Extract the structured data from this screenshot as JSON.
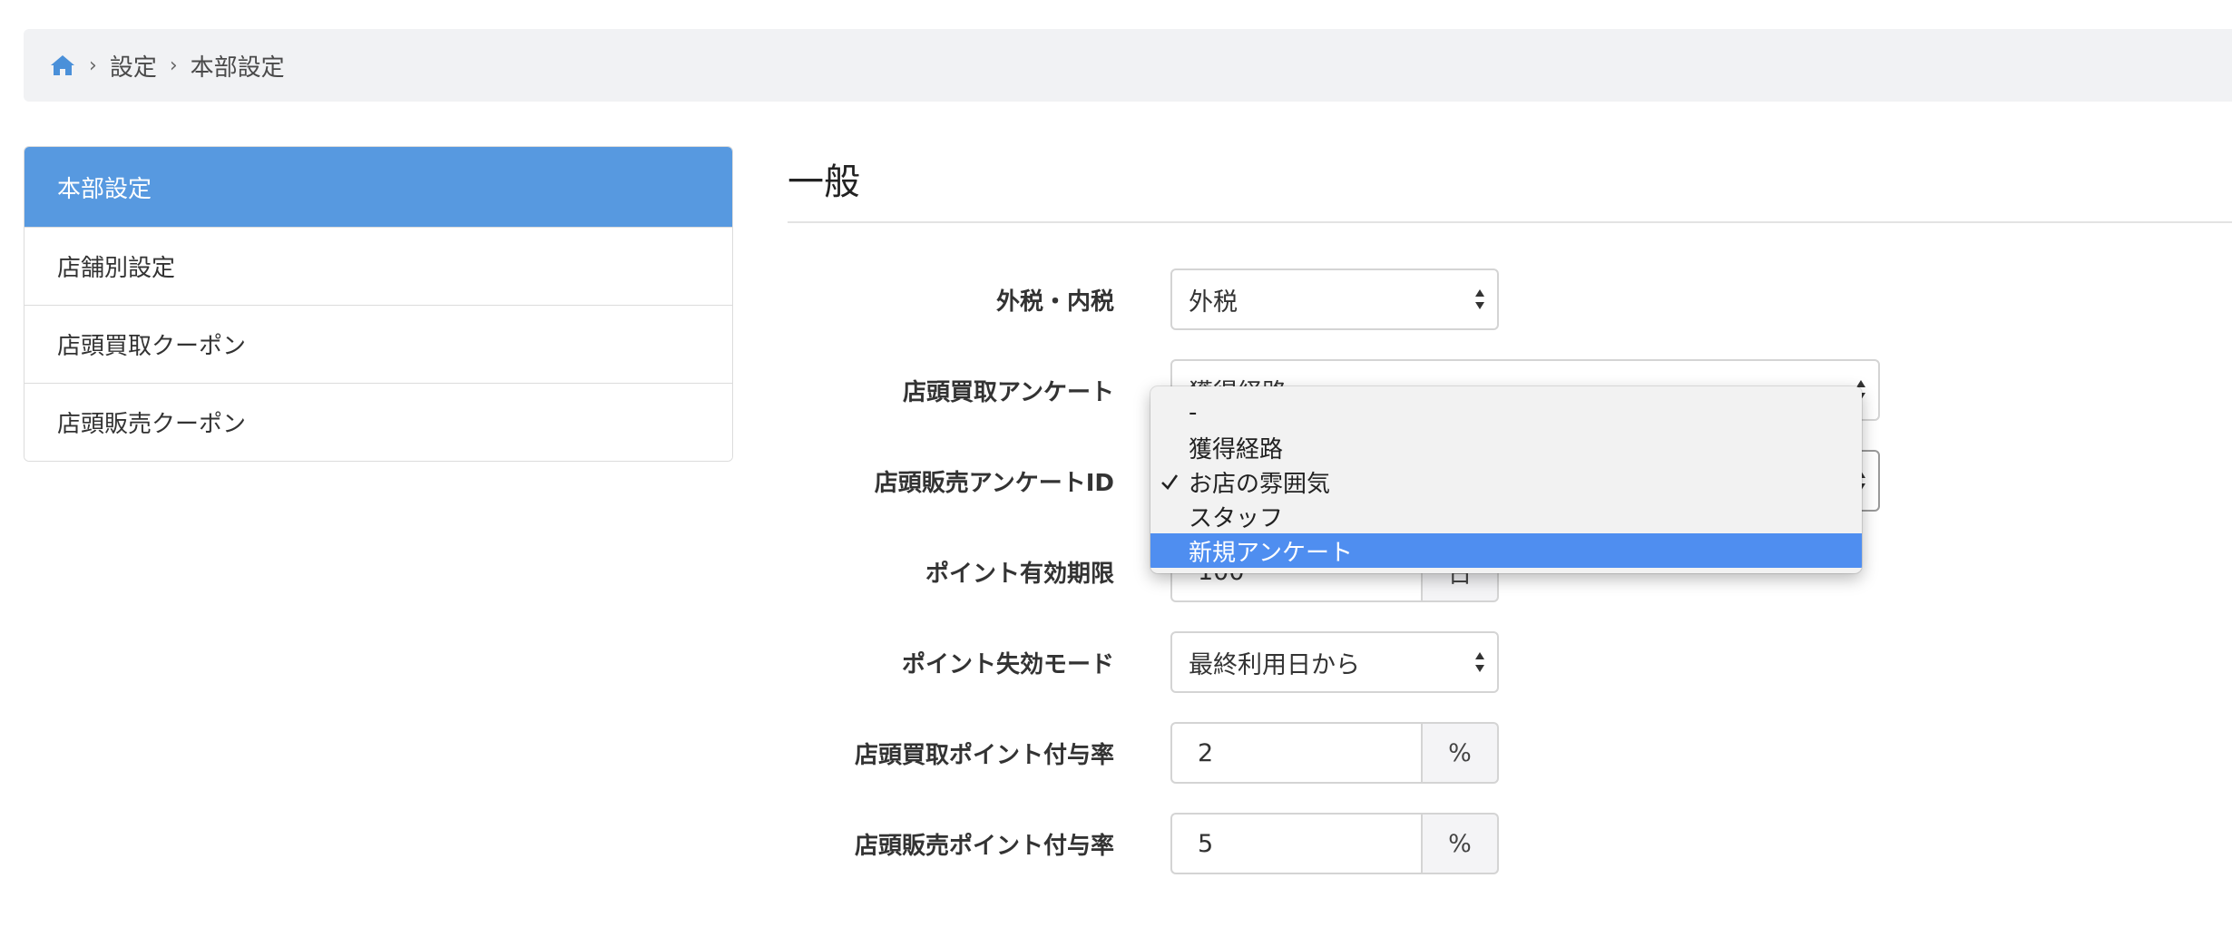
{
  "breadcrumb": {
    "items": [
      "設定",
      "本部設定"
    ]
  },
  "sidebar": {
    "items": [
      {
        "label": "本部設定"
      },
      {
        "label": "店舗別設定"
      },
      {
        "label": "店頭買取クーポン"
      },
      {
        "label": "店頭販売クーポン"
      }
    ]
  },
  "section": {
    "title": "一般"
  },
  "form": {
    "tax": {
      "label": "外税・内税",
      "value": "外税"
    },
    "purchase_survey": {
      "label": "店頭買取アンケート",
      "value": "獲得経路"
    },
    "sales_survey": {
      "label": "店頭販売アンケートID"
    },
    "point_expiry": {
      "label": "ポイント有効期限",
      "value": "100",
      "unit": "日"
    },
    "expiry_mode": {
      "label": "ポイント失効モード",
      "value": "最終利用日から"
    },
    "purchase_rate": {
      "label": "店頭買取ポイント付与率",
      "value": "2",
      "unit": "%"
    },
    "sales_rate": {
      "label": "店頭販売ポイント付与率",
      "value": "5",
      "unit": "%"
    }
  },
  "dropdown": {
    "options": [
      "-",
      "獲得経路",
      "お店の雰囲気",
      "スタッフ",
      "新規アンケート"
    ],
    "checked_index": 2,
    "highlighted_index": 4
  },
  "colors": {
    "accent": "#5799e0",
    "highlight": "#4f8ef0",
    "breadcrumb_bg": "#f1f2f4"
  }
}
